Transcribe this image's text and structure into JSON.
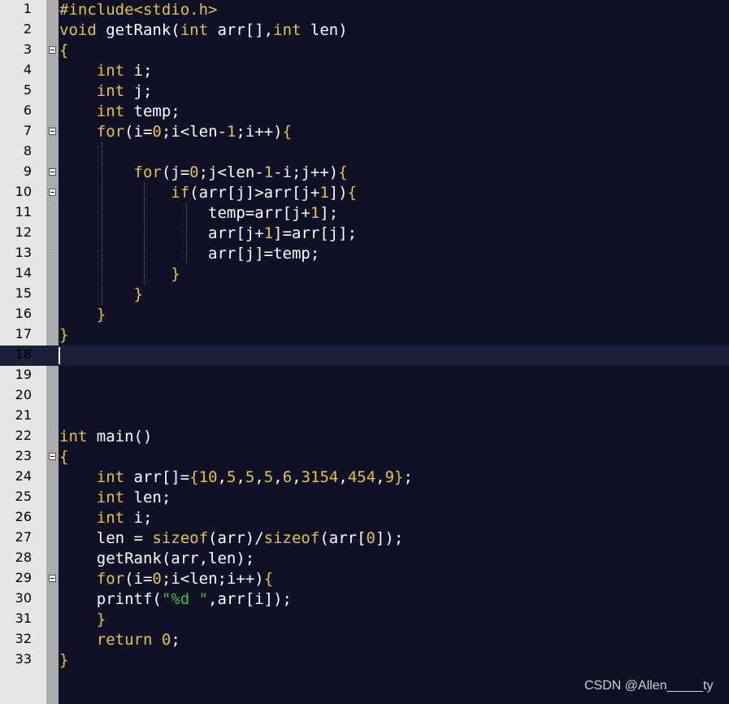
{
  "editor": {
    "lines": [
      {
        "num": "1",
        "segs": [
          {
            "t": "#include<stdio.h>",
            "c": "k"
          }
        ]
      },
      {
        "num": "2",
        "segs": [
          {
            "t": "void",
            "c": "k"
          },
          {
            "t": " getRank(",
            "c": "o"
          },
          {
            "t": "int",
            "c": "k"
          },
          {
            "t": " arr[],",
            "c": "o"
          },
          {
            "t": "int",
            "c": "k"
          },
          {
            "t": " len)",
            "c": "o"
          }
        ]
      },
      {
        "num": "3",
        "fold": true,
        "segs": [
          {
            "t": "{",
            "c": "k"
          }
        ]
      },
      {
        "num": "4",
        "segs": [
          {
            "t": "    ",
            "c": "o"
          },
          {
            "t": "int",
            "c": "k"
          },
          {
            "t": " i;",
            "c": "o"
          }
        ]
      },
      {
        "num": "5",
        "segs": [
          {
            "t": "    ",
            "c": "o"
          },
          {
            "t": "int",
            "c": "k"
          },
          {
            "t": " j;",
            "c": "o"
          }
        ]
      },
      {
        "num": "6",
        "segs": [
          {
            "t": "    ",
            "c": "o"
          },
          {
            "t": "int",
            "c": "k"
          },
          {
            "t": " temp;",
            "c": "o"
          }
        ]
      },
      {
        "num": "7",
        "fold": true,
        "segs": [
          {
            "t": "    ",
            "c": "o"
          },
          {
            "t": "for",
            "c": "k"
          },
          {
            "t": "(i=",
            "c": "o"
          },
          {
            "t": "0",
            "c": "n"
          },
          {
            "t": ";i<len-",
            "c": "o"
          },
          {
            "t": "1",
            "c": "n"
          },
          {
            "t": ";i++)",
            "c": "o"
          },
          {
            "t": "{",
            "c": "k"
          }
        ]
      },
      {
        "num": "8",
        "segs": []
      },
      {
        "num": "9",
        "fold": true,
        "segs": [
          {
            "t": "        ",
            "c": "o"
          },
          {
            "t": "for",
            "c": "k"
          },
          {
            "t": "(j=",
            "c": "o"
          },
          {
            "t": "0",
            "c": "n"
          },
          {
            "t": ";j<len-",
            "c": "o"
          },
          {
            "t": "1",
            "c": "n"
          },
          {
            "t": "-i;j++)",
            "c": "o"
          },
          {
            "t": "{",
            "c": "k"
          }
        ]
      },
      {
        "num": "10",
        "fold": true,
        "segs": [
          {
            "t": "            ",
            "c": "o"
          },
          {
            "t": "if",
            "c": "k"
          },
          {
            "t": "(arr[j]>arr[j+",
            "c": "o"
          },
          {
            "t": "1",
            "c": "n"
          },
          {
            "t": "])",
            "c": "o"
          },
          {
            "t": "{",
            "c": "k"
          }
        ]
      },
      {
        "num": "11",
        "segs": [
          {
            "t": "                temp=arr[j+",
            "c": "o"
          },
          {
            "t": "1",
            "c": "n"
          },
          {
            "t": "];",
            "c": "o"
          }
        ]
      },
      {
        "num": "12",
        "segs": [
          {
            "t": "                arr[j+",
            "c": "o"
          },
          {
            "t": "1",
            "c": "n"
          },
          {
            "t": "]=arr[j];",
            "c": "o"
          }
        ]
      },
      {
        "num": "13",
        "segs": [
          {
            "t": "                arr[j]=temp;",
            "c": "o"
          }
        ]
      },
      {
        "num": "14",
        "segs": [
          {
            "t": "            ",
            "c": "o"
          },
          {
            "t": "}",
            "c": "k"
          }
        ]
      },
      {
        "num": "15",
        "segs": [
          {
            "t": "        ",
            "c": "o"
          },
          {
            "t": "}",
            "c": "k"
          }
        ]
      },
      {
        "num": "16",
        "segs": [
          {
            "t": "    ",
            "c": "o"
          },
          {
            "t": "}",
            "c": "k"
          }
        ]
      },
      {
        "num": "17",
        "segs": [
          {
            "t": "}",
            "c": "k"
          }
        ]
      },
      {
        "num": "18",
        "current": true,
        "segs": []
      },
      {
        "num": "19",
        "segs": []
      },
      {
        "num": "20",
        "segs": []
      },
      {
        "num": "21",
        "segs": []
      },
      {
        "num": "22",
        "segs": [
          {
            "t": "int",
            "c": "k"
          },
          {
            "t": " main()",
            "c": "o"
          }
        ]
      },
      {
        "num": "23",
        "fold": true,
        "segs": [
          {
            "t": "{",
            "c": "k"
          }
        ]
      },
      {
        "num": "24",
        "segs": [
          {
            "t": "    ",
            "c": "o"
          },
          {
            "t": "int",
            "c": "k"
          },
          {
            "t": " arr[]=",
            "c": "o"
          },
          {
            "t": "{",
            "c": "k"
          },
          {
            "t": "10",
            "c": "n"
          },
          {
            "t": ",",
            "c": "o"
          },
          {
            "t": "5",
            "c": "n"
          },
          {
            "t": ",",
            "c": "o"
          },
          {
            "t": "5",
            "c": "n"
          },
          {
            "t": ",",
            "c": "o"
          },
          {
            "t": "5",
            "c": "n"
          },
          {
            "t": ",",
            "c": "o"
          },
          {
            "t": "6",
            "c": "n"
          },
          {
            "t": ",",
            "c": "o"
          },
          {
            "t": "3154",
            "c": "n"
          },
          {
            "t": ",",
            "c": "o"
          },
          {
            "t": "454",
            "c": "n"
          },
          {
            "t": ",",
            "c": "o"
          },
          {
            "t": "9",
            "c": "n"
          },
          {
            "t": "}",
            "c": "k"
          },
          {
            "t": ";",
            "c": "o"
          }
        ]
      },
      {
        "num": "25",
        "segs": [
          {
            "t": "    ",
            "c": "o"
          },
          {
            "t": "int",
            "c": "k"
          },
          {
            "t": " len;",
            "c": "o"
          }
        ]
      },
      {
        "num": "26",
        "segs": [
          {
            "t": "    ",
            "c": "o"
          },
          {
            "t": "int",
            "c": "k"
          },
          {
            "t": " i;",
            "c": "o"
          }
        ]
      },
      {
        "num": "27",
        "segs": [
          {
            "t": "    len = ",
            "c": "o"
          },
          {
            "t": "sizeof",
            "c": "k"
          },
          {
            "t": "(arr)/",
            "c": "o"
          },
          {
            "t": "sizeof",
            "c": "k"
          },
          {
            "t": "(arr[",
            "c": "o"
          },
          {
            "t": "0",
            "c": "n"
          },
          {
            "t": "]);",
            "c": "o"
          }
        ]
      },
      {
        "num": "28",
        "segs": [
          {
            "t": "    getRank(arr,len);",
            "c": "o"
          }
        ]
      },
      {
        "num": "29",
        "fold": true,
        "segs": [
          {
            "t": "    ",
            "c": "o"
          },
          {
            "t": "for",
            "c": "k"
          },
          {
            "t": "(i=",
            "c": "o"
          },
          {
            "t": "0",
            "c": "n"
          },
          {
            "t": ";i<len;i++)",
            "c": "o"
          },
          {
            "t": "{",
            "c": "k"
          }
        ]
      },
      {
        "num": "30",
        "segs": [
          {
            "t": "    printf(",
            "c": "o"
          },
          {
            "t": "\"%d \"",
            "c": "s"
          },
          {
            "t": ",arr[i]);",
            "c": "o"
          }
        ]
      },
      {
        "num": "31",
        "segs": [
          {
            "t": "    ",
            "c": "o"
          },
          {
            "t": "}",
            "c": "k"
          }
        ]
      },
      {
        "num": "32",
        "segs": [
          {
            "t": "    ",
            "c": "o"
          },
          {
            "t": "return",
            "c": "k"
          },
          {
            "t": " ",
            "c": "o"
          },
          {
            "t": "0",
            "c": "n"
          },
          {
            "t": ";",
            "c": "o"
          }
        ]
      },
      {
        "num": "33",
        "segs": [
          {
            "t": "}",
            "c": "k"
          }
        ]
      }
    ]
  },
  "watermark": "CSDN @Allen_____ty",
  "colors": {
    "background": "#0f1126",
    "keyword": "#e9c040",
    "string": "#3bc23b",
    "text": "#ffffff",
    "gutter": "#e6e6e6"
  }
}
